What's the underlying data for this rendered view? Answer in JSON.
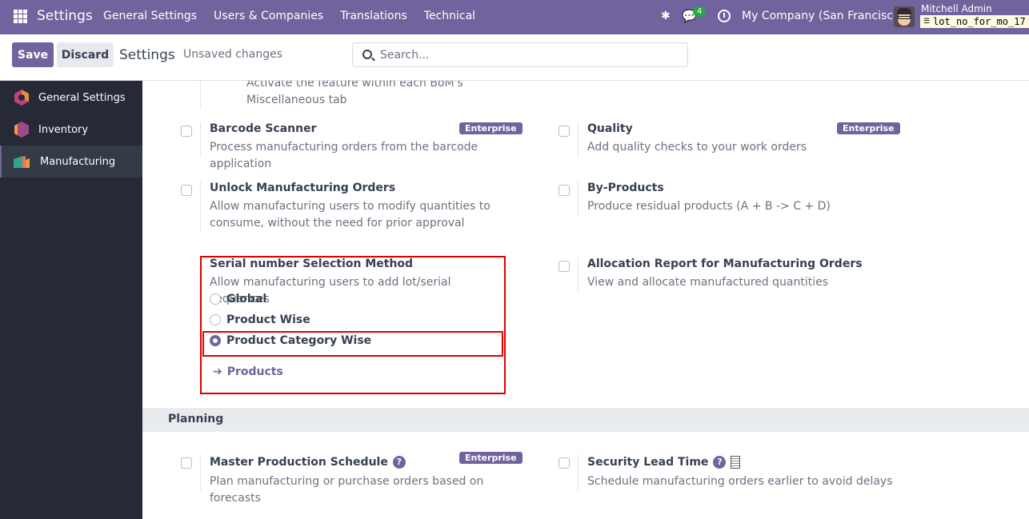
{
  "navbar": {
    "brand": "Settings",
    "menu": [
      "General Settings",
      "Users & Companies",
      "Translations",
      "Technical"
    ],
    "chat_count": "4",
    "company": "My Company (San Francisco)",
    "user_name": "Mitchell Admin",
    "database": "lot_no_for_mo_17",
    "icons": [
      "apps-grid-icon",
      "bug-icon",
      "chat-icon",
      "clock-icon",
      "database-icon"
    ]
  },
  "control_panel": {
    "save_label": "Save",
    "discard_label": "Discard",
    "title": "Settings",
    "status": "Unsaved changes",
    "search_placeholder": "Search..."
  },
  "sidebar": {
    "items": [
      {
        "label": "General Settings",
        "active": false
      },
      {
        "label": "Inventory",
        "active": false
      },
      {
        "label": "Manufacturing",
        "active": true
      }
    ]
  },
  "content": {
    "partial_top": {
      "desc": "Activate the feature within each BoM's Miscellaneous tab"
    },
    "settings": {
      "barcode": {
        "title": "Barcode Scanner",
        "desc": "Process manufacturing orders from the barcode application",
        "badge": "Enterprise",
        "checked": false
      },
      "quality": {
        "title": "Quality",
        "desc": "Add quality checks to your work orders",
        "badge": "Enterprise",
        "checked": false
      },
      "unlock": {
        "title": "Unlock Manufacturing Orders",
        "desc": "Allow manufacturing users to modify quantities to consume, without the need for prior approval",
        "checked": false
      },
      "byproducts": {
        "title": "By-Products",
        "desc": "Produce residual products (A + B -> C + D)",
        "checked": false
      },
      "serial": {
        "title": "Serial number Selection Method",
        "desc": "Allow manufacturing users to add lot/serial sequences",
        "options": [
          "Global",
          "Product Wise",
          "Product Category Wise"
        ],
        "selected": "Product Category Wise",
        "link": "Products"
      },
      "allocation": {
        "title": "Allocation Report for Manufacturing Orders",
        "desc": "View and allocate manufactured quantities",
        "checked": false
      }
    },
    "planning": {
      "header": "Planning",
      "mps": {
        "title": "Master Production Schedule",
        "desc": "Plan manufacturing or purchase orders based on forecasts",
        "badge": "Enterprise",
        "checked": false
      },
      "lead_time": {
        "title": "Security Lead Time",
        "desc": "Schedule manufacturing orders earlier to avoid delays",
        "checked": false
      }
    }
  },
  "colors": {
    "brand": "#71639e",
    "highlight_border": "#e00000",
    "sidebar_bg": "#262a36"
  }
}
